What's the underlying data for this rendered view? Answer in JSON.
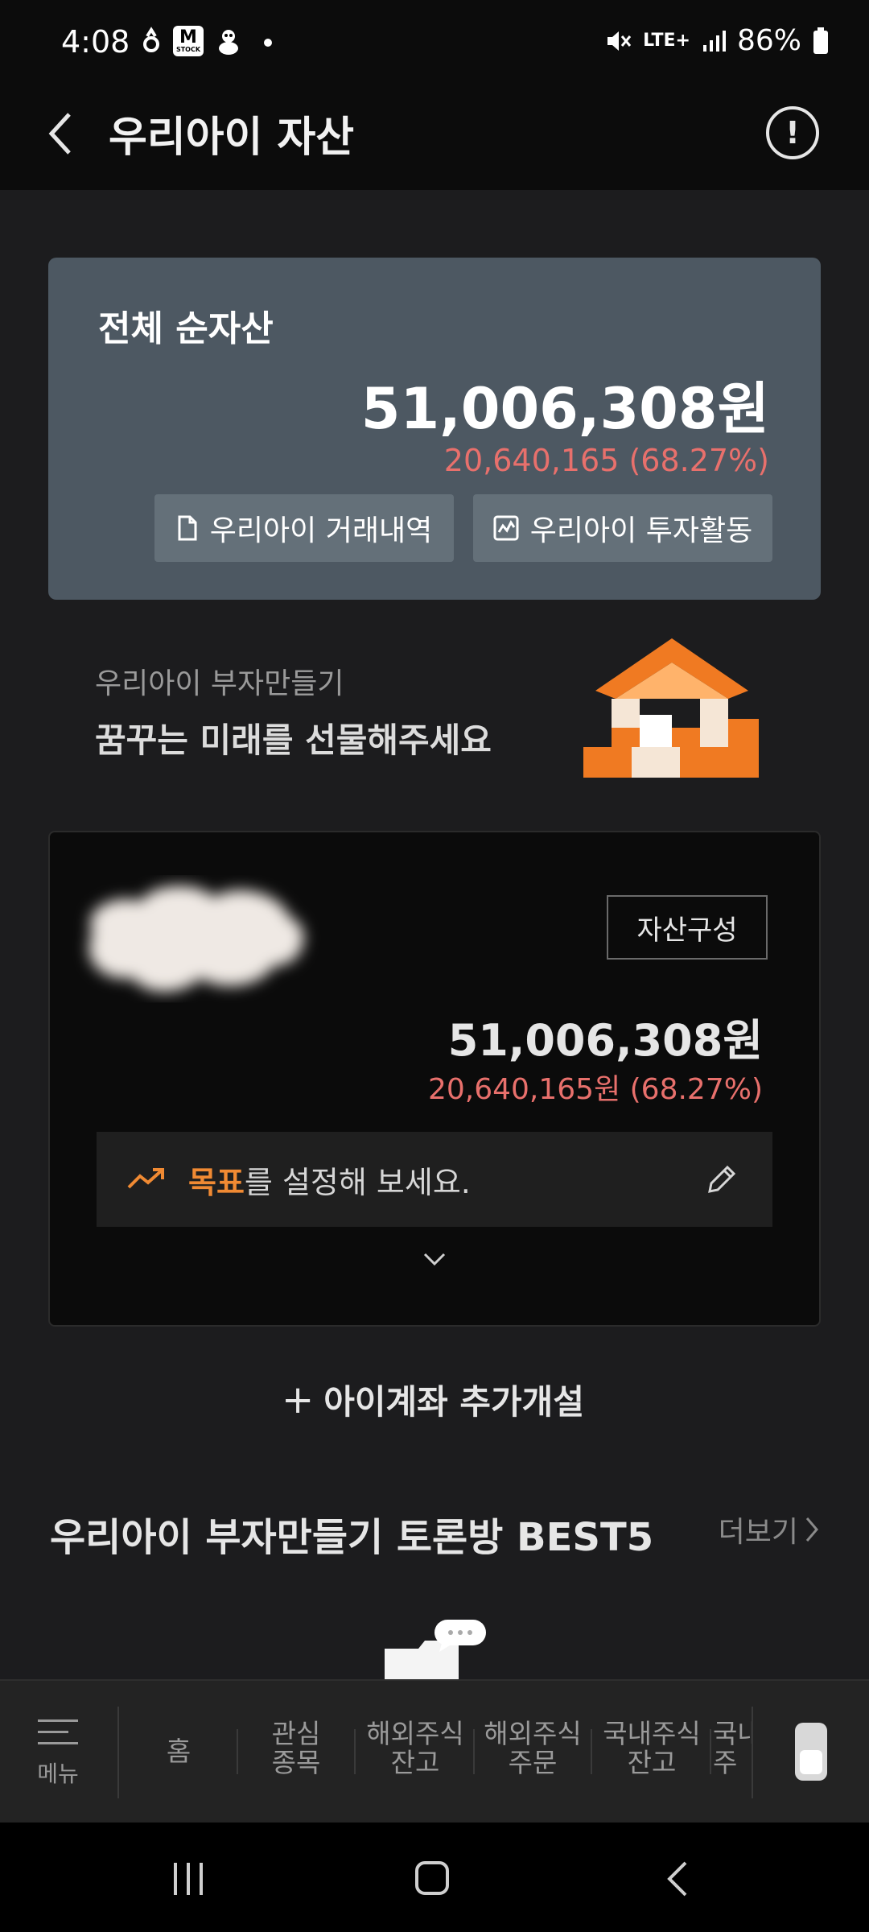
{
  "status_bar": {
    "time": "4:08",
    "network": "LTE+",
    "battery": "86%",
    "icons": [
      "notification-icon",
      "mstock-app-icon",
      "character-icon",
      "dot-icon",
      "mute-icon",
      "signal-icon",
      "battery-icon"
    ]
  },
  "header": {
    "title": "우리아이 자산",
    "info_symbol": "!"
  },
  "summary": {
    "label": "전체 순자산",
    "amount": "51,006,308원",
    "change": "20,640,165 (68.27%)",
    "buttons": {
      "history": "우리아이 거래내역",
      "activity": "우리아이 투자활동"
    }
  },
  "promo": {
    "subtitle": "우리아이 부자만들기",
    "title": "꿈꾸는 미래를 선물해주세요"
  },
  "account": {
    "composition_label": "자산구성",
    "amount": "51,006,308원",
    "change": "20,640,165원 (68.27%)",
    "goal": {
      "highlight": "목표",
      "text": "를 설정해 보세요."
    }
  },
  "add_account": {
    "plus": "+",
    "label": "아이계좌 추가개설"
  },
  "best5": {
    "title": "우리아이 부자만들기 토론방 BEST5",
    "more": "더보기"
  },
  "tab_bar": {
    "menu_label": "메뉴",
    "tabs": [
      {
        "line1": "홈",
        "line2": ""
      },
      {
        "line1": "관심",
        "line2": "종목"
      },
      {
        "line1": "해외주식",
        "line2": "잔고"
      },
      {
        "line1": "해외주식",
        "line2": "주문"
      },
      {
        "line1": "국내주식",
        "line2": "잔고"
      },
      {
        "line1": "국내",
        "line2": "주"
      }
    ]
  },
  "colors": {
    "background": "#1c1c1e",
    "card": "#4d5862",
    "positive_change": "#e8706c",
    "accent_orange": "#f08a33"
  }
}
